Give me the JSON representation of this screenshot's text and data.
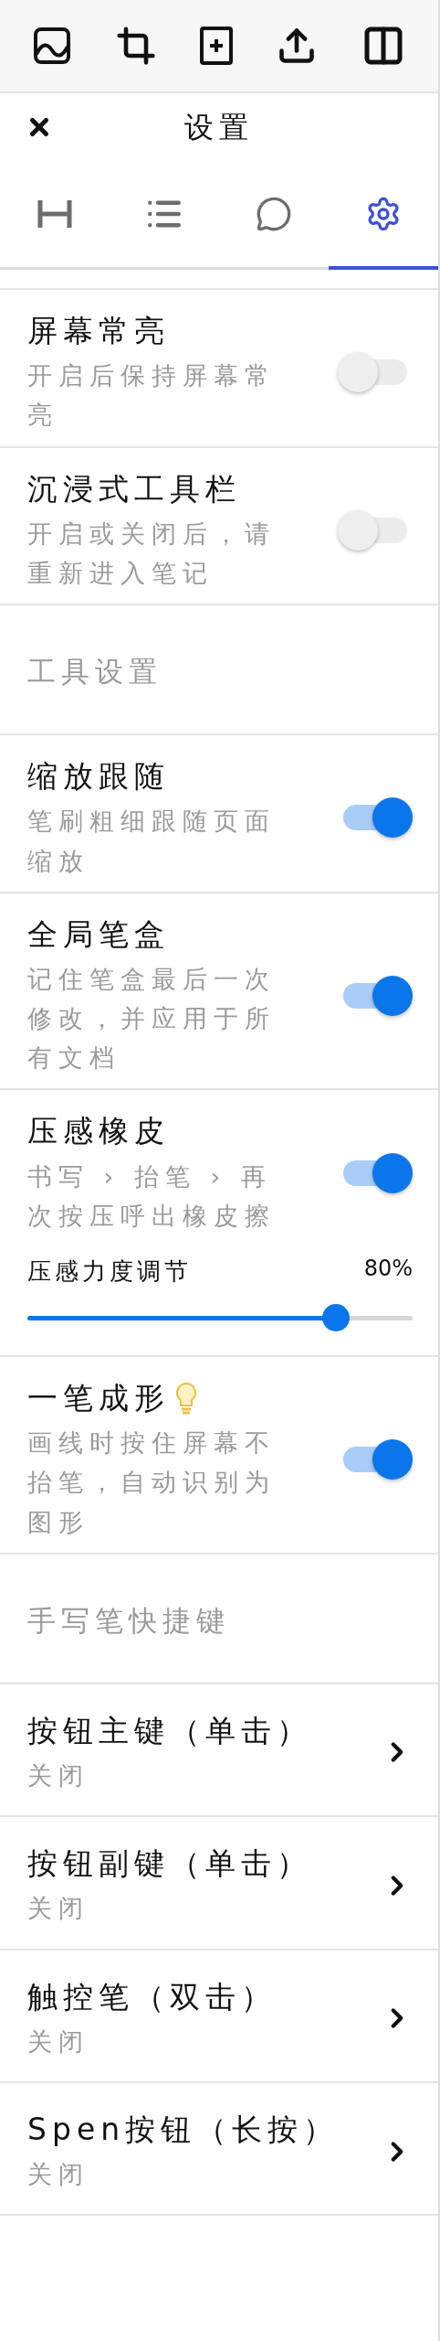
{
  "header": {
    "title": "设置"
  },
  "tabs": [
    {
      "kind": "spacing",
      "selected": false
    },
    {
      "kind": "list",
      "selected": false
    },
    {
      "kind": "comment",
      "selected": false
    },
    {
      "kind": "settings",
      "selected": true
    }
  ],
  "items": [
    {
      "kind": "toggle",
      "title": "屏幕常亮",
      "description": "开启后保持屏幕常亮",
      "on": false
    },
    {
      "kind": "toggle",
      "title": "沉浸式工具栏",
      "description": "开启或关闭后，请重新进入笔记",
      "on": false
    },
    {
      "kind": "section",
      "title": "工具设置"
    },
    {
      "kind": "toggle",
      "title": "缩放跟随",
      "description": "笔刷粗细跟随页面缩放",
      "on": true
    },
    {
      "kind": "toggle",
      "title": "全局笔盒",
      "description": "记住笔盒最后一次修改，并应用于所有文档",
      "on": true
    },
    {
      "kind": "toggle",
      "title": "压感橡皮",
      "description": "书写 › 抬笔 › 再次按压呼出橡皮擦",
      "on": true,
      "slider": {
        "label": "压感力度调节",
        "reading": "80%",
        "level": 0.8
      }
    },
    {
      "kind": "toggle",
      "title": "一笔成形",
      "description": "画线时按住屏幕不抬笔，自动识别为图形",
      "on": true,
      "tip": true
    },
    {
      "kind": "section",
      "title": "手写笔快捷键"
    },
    {
      "kind": "link",
      "title": "按钮主键（单击）",
      "value": "关闭"
    },
    {
      "kind": "link",
      "title": "按钮副键（单击）",
      "value": "关闭"
    },
    {
      "kind": "link",
      "title": "触控笔（双击）",
      "value": "关闭"
    },
    {
      "kind": "link",
      "title": "Spen按钮（长按）",
      "value": "关闭"
    }
  ]
}
